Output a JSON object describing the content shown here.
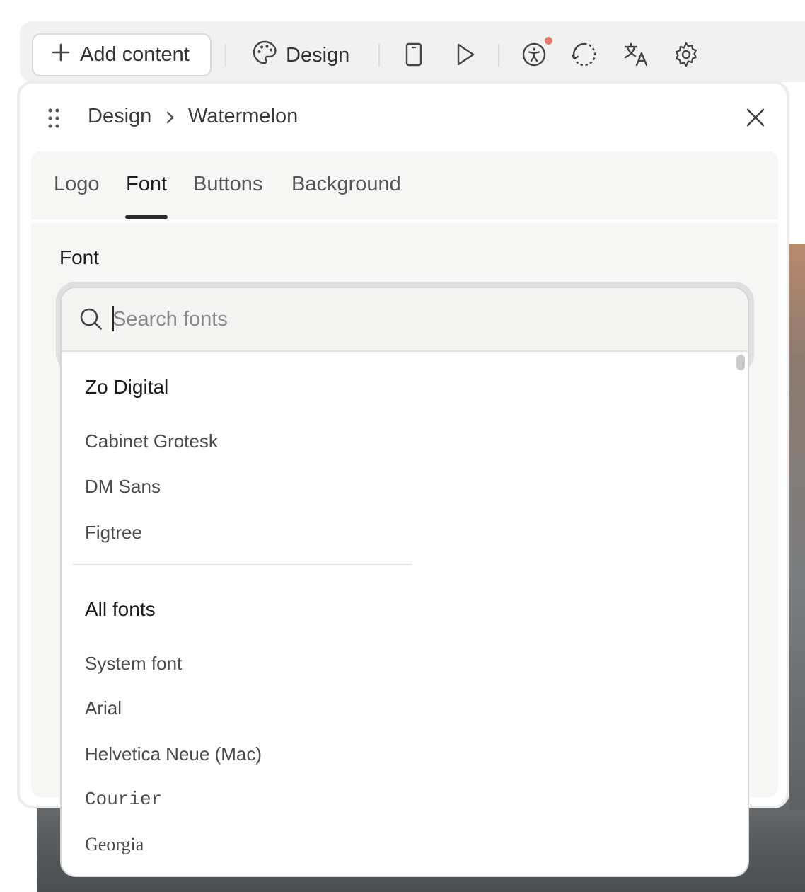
{
  "toolbar": {
    "add_content_label": "Add content",
    "design_label": "Design",
    "icons": [
      "plus-icon",
      "palette-icon",
      "phone-preview-icon",
      "play-icon",
      "accessibility-icon",
      "history-icon",
      "translate-icon",
      "settings-icon"
    ],
    "notification_color": "#e77b6b"
  },
  "panel": {
    "breadcrumb": {
      "parent": "Design",
      "current": "Watermelon"
    },
    "tabs": [
      {
        "label": "Logo",
        "active": false
      },
      {
        "label": "Font",
        "active": true
      },
      {
        "label": "Buttons",
        "active": false
      },
      {
        "label": "Background",
        "active": false
      }
    ],
    "section_label": "Font"
  },
  "font_picker": {
    "search": {
      "value": "",
      "placeholder": "Search fonts"
    },
    "groups": [
      {
        "title": "Zo Digital",
        "fonts": [
          "Cabinet Grotesk",
          "DM Sans",
          "Figtree"
        ]
      },
      {
        "title": "All fonts",
        "fonts": [
          "System font",
          "Arial",
          "Helvetica Neue (Mac)",
          "Courier",
          "Georgia"
        ]
      }
    ]
  }
}
